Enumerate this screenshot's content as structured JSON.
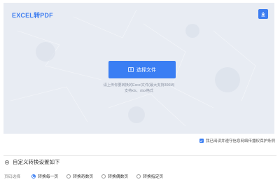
{
  "app": {
    "title": "EXCEL转PDF"
  },
  "upload": {
    "button_label": "选择文件",
    "hint_line1": "请上传你要转换的Excel文件(最大支持300M)",
    "hint_line2": "支持xls、xlsx格式"
  },
  "agreement": {
    "label": "我已阅读并遵守信息网络传播权保护条例",
    "checked": true
  },
  "settings": {
    "title": "自定义转换设置如下",
    "page_select_label": "页码选择",
    "options": [
      {
        "label": "转换每一页",
        "selected": true
      },
      {
        "label": "转换奇数页",
        "selected": false
      },
      {
        "label": "转换偶数页",
        "selected": false
      },
      {
        "label": "转换指定页",
        "selected": false
      }
    ]
  },
  "colors": {
    "accent": "#3a7ef3",
    "panel_bg": "#e8ecf3"
  }
}
